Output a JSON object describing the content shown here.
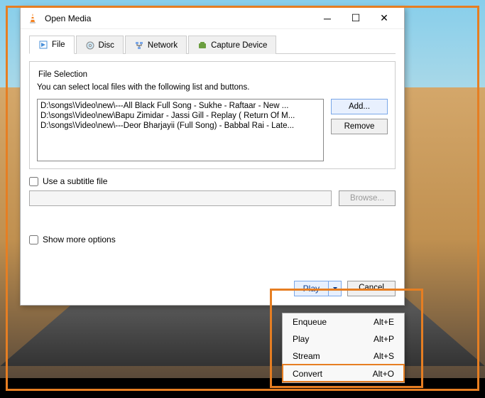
{
  "window": {
    "title": "Open Media"
  },
  "tabs": {
    "file": "File",
    "disc": "Disc",
    "network": "Network",
    "capture": "Capture Device"
  },
  "fileSelection": {
    "legend": "File Selection",
    "hint": "You can select local files with the following list and buttons.",
    "files": [
      "D:\\songs\\Video\\new\\---All Black Full Song - Sukhe - Raftaar -  New ...",
      "D:\\songs\\Video\\new\\Bapu Zimidar - Jassi Gill - Replay ( Return Of M...",
      "D:\\songs\\Video\\new\\---Deor Bharjayii (Full Song) - Babbal Rai - Late..."
    ],
    "add": "Add...",
    "remove": "Remove"
  },
  "subtitle": {
    "label": "Use a subtitle file",
    "browse": "Browse..."
  },
  "showMore": "Show more options",
  "footer": {
    "play": "Play",
    "cancel": "Cancel"
  },
  "menu": {
    "items": [
      {
        "label": "Enqueue",
        "shortcut": "Alt+E"
      },
      {
        "label": "Play",
        "shortcut": "Alt+P"
      },
      {
        "label": "Stream",
        "shortcut": "Alt+S"
      },
      {
        "label": "Convert",
        "shortcut": "Alt+O"
      }
    ]
  }
}
